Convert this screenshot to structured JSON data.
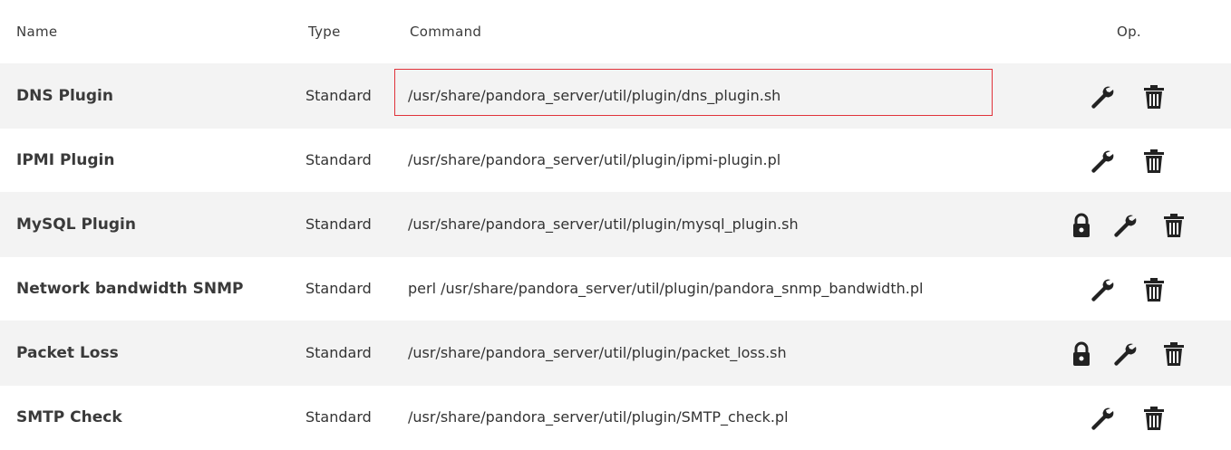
{
  "table": {
    "headers": {
      "name": "Name",
      "type": "Type",
      "command": "Command",
      "op": "Op."
    },
    "rows": [
      {
        "name": "DNS Plugin",
        "type": "Standard",
        "command": "/usr/share/pandora_server/util/plugin/dns_plugin.sh",
        "locked": false,
        "highlighted": true
      },
      {
        "name": "IPMI Plugin",
        "type": "Standard",
        "command": "/usr/share/pandora_server/util/plugin/ipmi-plugin.pl",
        "locked": false,
        "highlighted": false
      },
      {
        "name": "MySQL Plugin",
        "type": "Standard",
        "command": "/usr/share/pandora_server/util/plugin/mysql_plugin.sh",
        "locked": true,
        "highlighted": false
      },
      {
        "name": "Network bandwidth SNMP",
        "type": "Standard",
        "command": "perl /usr/share/pandora_server/util/plugin/pandora_snmp_bandwidth.pl",
        "locked": false,
        "highlighted": false
      },
      {
        "name": "Packet Loss",
        "type": "Standard",
        "command": "/usr/share/pandora_server/util/plugin/packet_loss.sh",
        "locked": true,
        "highlighted": false
      },
      {
        "name": "SMTP Check",
        "type": "Standard",
        "command": "/usr/share/pandora_server/util/plugin/SMTP_check.pl",
        "locked": false,
        "highlighted": false
      }
    ]
  },
  "icons": {
    "lock": "lock-icon",
    "edit": "wrench-icon",
    "delete": "trash-icon"
  },
  "colors": {
    "row_alt": "#f3f3f3",
    "highlight_border": "#e0333b",
    "icon": "#222222"
  }
}
